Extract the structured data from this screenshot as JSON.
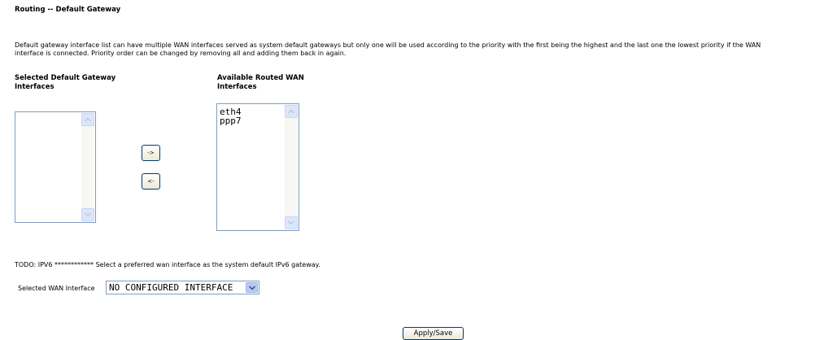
{
  "page": {
    "title": "Routing -- Default Gateway",
    "description_line1": "Default gateway interface list can have multiple WAN interfaces served as system default gateways but only one will be used according to the priority with the first being the highest and the last one the lowest priority if the WAN",
    "description_line2": "interface is connected. Priority order can be changed by removing all and adding them back in again."
  },
  "selected_list": {
    "header_line1": "Selected Default Gateway",
    "header_line2": "Interfaces",
    "items": []
  },
  "available_list": {
    "header_line1": "Available Routed WAN",
    "header_line2": "Interfaces",
    "items": [
      "eth4",
      "ppp7"
    ]
  },
  "buttons": {
    "move_right": "->",
    "move_left": "<-",
    "apply": "Apply/Save"
  },
  "ipv6": {
    "todo_text": "TODO: IPV6 ************ Select a preferred wan interface as the system default IPv6 gateway.",
    "wan_label": "Selected WAN Interface",
    "wan_value": "NO CONFIGURED INTERFACE"
  },
  "icons": {
    "scroll_up": "chevron-up-icon",
    "scroll_down": "chevron-down-icon",
    "dropdown": "chevron-down-icon"
  },
  "colors": {
    "listbox_border": "#7f9db9",
    "scrollbar_button": "#dde7fc",
    "dropdown_button": "#b7cbf7"
  }
}
